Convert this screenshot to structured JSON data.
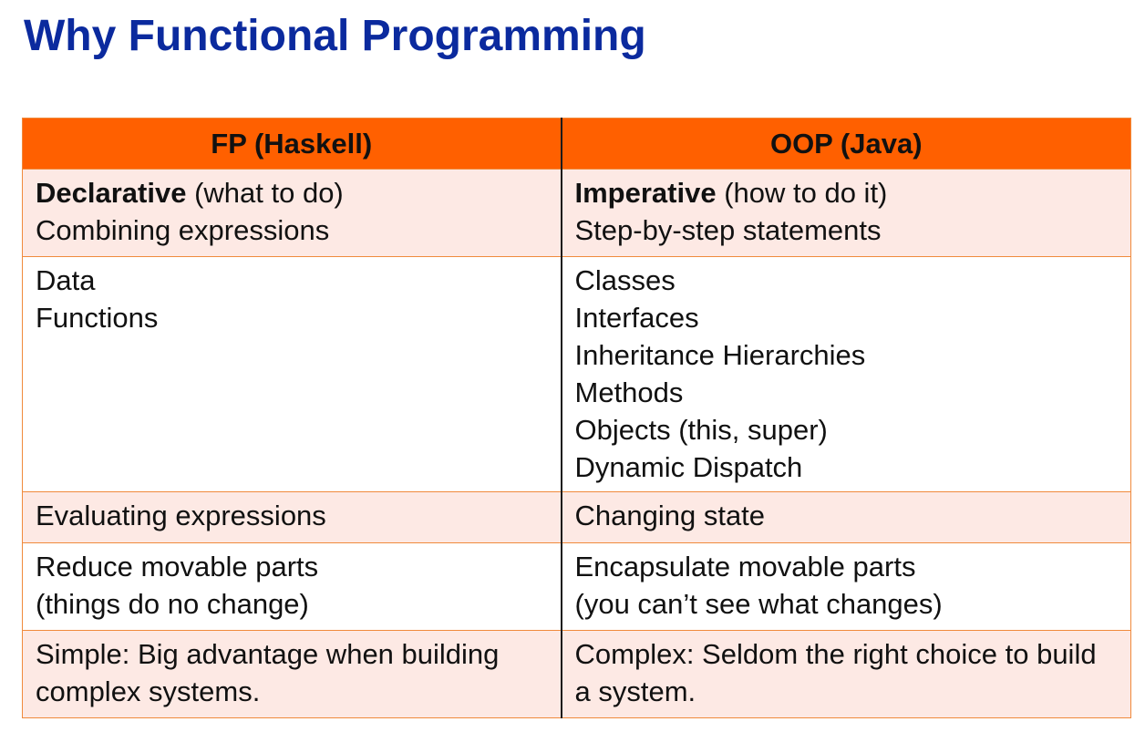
{
  "title": "Why Functional Programming",
  "table": {
    "headers": [
      "FP (Haskell)",
      "OOP (Java)"
    ],
    "rows": [
      {
        "fp": {
          "bold": "Declarative",
          "rest": " (what to do)",
          "lines": [
            "Combining expressions"
          ]
        },
        "oop": {
          "bold": "Imperative",
          "rest": " (how to do it)",
          "lines": [
            "Step-by-step statements"
          ]
        }
      },
      {
        "fp": {
          "lines": [
            "Data",
            "Functions"
          ]
        },
        "oop": {
          "lines": [
            "Classes",
            "Interfaces",
            "Inheritance Hierarchies",
            "Methods",
            "Objects (this, super)",
            "Dynamic Dispatch"
          ]
        }
      },
      {
        "fp": {
          "lines": [
            "Evaluating expressions"
          ]
        },
        "oop": {
          "lines": [
            "Changing state"
          ]
        }
      },
      {
        "fp": {
          "lines": [
            "Reduce movable parts",
            "(things do no change)"
          ]
        },
        "oop": {
          "lines": [
            "Encapsulate movable parts",
            "(you can’t see what changes)"
          ]
        }
      },
      {
        "fp": {
          "text": "Simple: Big advantage when building complex systems."
        },
        "oop": {
          "text": "Complex: Seldom the right choice to build a system."
        }
      }
    ]
  },
  "colors": {
    "title": "#0b2a9e",
    "header_fill": "#ff6000",
    "shaded_row": "#fde9e4",
    "border": "#f08a3c"
  }
}
